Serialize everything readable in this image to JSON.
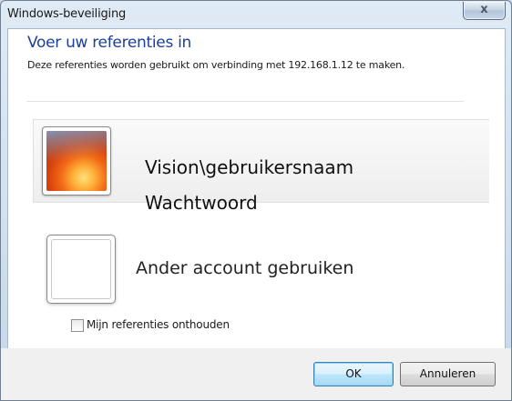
{
  "window": {
    "title": "Windows-beveiliging",
    "close_glyph": "x"
  },
  "dialog": {
    "heading": "Voer uw referenties in",
    "description": "Deze referenties worden gebruikt om verbinding met 192.168.1.12 te maken."
  },
  "selected_credential": {
    "icon": "user-flower-picture-icon",
    "username": "Vision\\gebruikersnaam",
    "password_label": "Wachtwoord"
  },
  "other_account": {
    "icon": "blank-user-tile-icon",
    "label": "Ander account gebruiken"
  },
  "remember": {
    "label": "Mijn referenties onthouden",
    "checked": false
  },
  "buttons": {
    "ok": "OK",
    "cancel": "Annuleren"
  },
  "colors": {
    "heading": "#1c3f9e",
    "default_button": "#3c7fb1"
  }
}
